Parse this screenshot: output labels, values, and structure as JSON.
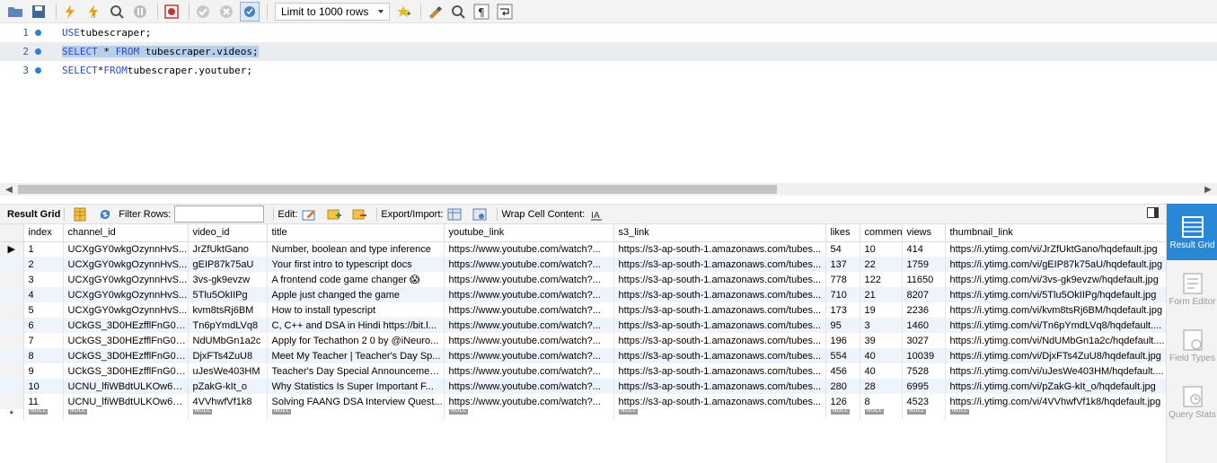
{
  "toolbar": {
    "limit_label": "Limit to 1000 rows"
  },
  "editor": {
    "lines": [
      {
        "num": "1",
        "text": "USE tubescraper;"
      },
      {
        "num": "2",
        "kw1": "SELECT",
        "mid": " * ",
        "kw2": "FROM",
        "rest": " tubescraper.videos;"
      },
      {
        "num": "3",
        "kw1": "SELECT",
        "mid": " * ",
        "kw2": "FROM",
        "rest": " tubescraper.youtuber;"
      }
    ],
    "line1_kw": "USE",
    "line1_rest": " tubescraper;"
  },
  "result_toolbar": {
    "result_grid": "Result Grid",
    "filter_rows": "Filter Rows:",
    "edit": "Edit:",
    "export_import": "Export/Import:",
    "wrap_cell": "Wrap Cell Content:"
  },
  "grid": {
    "columns": [
      "index",
      "channel_id",
      "video_id",
      "title",
      "youtube_link",
      "s3_link",
      "likes",
      "commen",
      "views",
      "thumbnail_link"
    ],
    "rows": [
      [
        "1",
        "UCXgGY0wkgOzynnHvS...",
        "JrZfUktGano",
        "Number, boolean and type inference",
        "https://www.youtube.com/watch?...",
        "https://s3-ap-south-1.amazonaws.com/tubes...",
        "54",
        "10",
        "414",
        "https://i.ytimg.com/vi/JrZfUktGano/hqdefault.jpg"
      ],
      [
        "2",
        "UCXgGY0wkgOzynnHvS...",
        "gEIP87k75aU",
        "Your first intro to typescript docs",
        "https://www.youtube.com/watch?...",
        "https://s3-ap-south-1.amazonaws.com/tubes...",
        "137",
        "22",
        "1759",
        "https://i.ytimg.com/vi/gEIP87k75aU/hqdefault.jpg"
      ],
      [
        "3",
        "UCXgGY0wkgOzynnHvS...",
        "3vs-gk9evzw",
        "A frontend code game changer 😱",
        "https://www.youtube.com/watch?...",
        "https://s3-ap-south-1.amazonaws.com/tubes...",
        "778",
        "122",
        "11650",
        "https://i.ytimg.com/vi/3vs-gk9evzw/hqdefault.jpg"
      ],
      [
        "4",
        "UCXgGY0wkgOzynnHvS...",
        "5Tlu5OkIIPg",
        "Apple just changed the game",
        "https://www.youtube.com/watch?...",
        "https://s3-ap-south-1.amazonaws.com/tubes...",
        "710",
        "21",
        "8207",
        "https://i.ytimg.com/vi/5Tlu5OkIIPg/hqdefault.jpg"
      ],
      [
        "5",
        "UCXgGY0wkgOzynnHvS...",
        "kvm8tsRj6BM",
        "How to install typescript",
        "https://www.youtube.com/watch?...",
        "https://s3-ap-south-1.amazonaws.com/tubes...",
        "173",
        "19",
        "2236",
        "https://i.ytimg.com/vi/kvm8tsRj6BM/hqdefault.jpg"
      ],
      [
        "6",
        "UCkGS_3D0HEzfflFnG0b...",
        "Tn6pYmdLVq8",
        "C, C++ and DSA in Hindi https://bit.l...",
        "https://www.youtube.com/watch?...",
        "https://s3-ap-south-1.amazonaws.com/tubes...",
        "95",
        "3",
        "1460",
        "https://i.ytimg.com/vi/Tn6pYmdLVq8/hqdefault...."
      ],
      [
        "7",
        "UCkGS_3D0HEzfflFnG0b...",
        "NdUMbGn1a2c",
        "Apply for Techathon 2 0 by @iNeuro...",
        "https://www.youtube.com/watch?...",
        "https://s3-ap-south-1.amazonaws.com/tubes...",
        "196",
        "39",
        "3027",
        "https://i.ytimg.com/vi/NdUMbGn1a2c/hqdefault...."
      ],
      [
        "8",
        "UCkGS_3D0HEzfflFnG0b...",
        "DjxFTs4ZuU8",
        "Meet My Teacher | Teacher's Day Sp...",
        "https://www.youtube.com/watch?...",
        "https://s3-ap-south-1.amazonaws.com/tubes...",
        "554",
        "40",
        "10039",
        "https://i.ytimg.com/vi/DjxFTs4ZuU8/hqdefault.jpg"
      ],
      [
        "9",
        "UCkGS_3D0HEzfflFnG0b...",
        "uJesWe403HM",
        "Teacher's Day Special Announcemen...",
        "https://www.youtube.com/watch?...",
        "https://s3-ap-south-1.amazonaws.com/tubes...",
        "456",
        "40",
        "7528",
        "https://i.ytimg.com/vi/uJesWe403HM/hqdefault...."
      ],
      [
        "10",
        "UCNU_lfiWBdtULKOw6X...",
        "pZakG-kIt_o",
        "Why Statistics Is Super Important F...",
        "https://www.youtube.com/watch?...",
        "https://s3-ap-south-1.amazonaws.com/tubes...",
        "280",
        "28",
        "6995",
        "https://i.ytimg.com/vi/pZakG-kIt_o/hqdefault.jpg"
      ],
      [
        "11",
        "UCNU_lfiWBdtULKOw6X...",
        "4VVhwfVf1k8",
        "Solving FAANG DSA Interview Quest...",
        "https://www.youtube.com/watch?...",
        "https://s3-ap-south-1.amazonaws.com/tubes...",
        "126",
        "8",
        "4523",
        "https://i.ytimg.com/vi/4VVhwfVf1k8/hqdefault.jpg"
      ]
    ],
    "null_label": "NULL",
    "new_row_marker": "*",
    "current_row_marker": "▶"
  },
  "right_panel": {
    "items": [
      "Result Grid",
      "Form Editor",
      "Field Types",
      "Query Stats"
    ]
  },
  "colors": {
    "accent": "#2a87d6",
    "keyword": "#2750c6",
    "selection": "#b7cfea",
    "alt_row": "#eef4fb"
  }
}
